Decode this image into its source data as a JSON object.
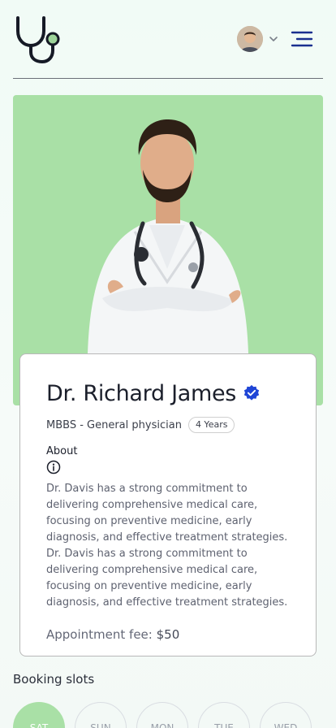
{
  "header": {
    "logo_icon": "stethoscope-icon",
    "avatar_icon": "user-avatar",
    "chevron_icon": "chevron-down-icon",
    "menu_icon": "hamburger-menu-icon",
    "brand_color": "#1b1f3a",
    "accent_color": "#1a3fc4"
  },
  "doctor": {
    "name": "Dr. Richard James",
    "verified_icon": "verified-badge-icon",
    "degree": "MBBS - General physician",
    "experience": "4 Years",
    "about_title": "About",
    "about_text": "Dr. Davis has a strong commitment to delivering comprehensive medical care, focusing on preventive medicine, early diagnosis, and effective treatment strategies. Dr. Davis has a strong commitment to delivering comprehensive medical care, focusing on preventive medicine, early diagnosis, and effective treatment strategies.",
    "fee_label": "Appointment fee:",
    "fee_value": "$50",
    "hero_bg_color": "#a9e0a6"
  },
  "booking": {
    "title": "Booking slots",
    "days": [
      "SAT",
      "SUN",
      "MON",
      "TUE",
      "WED"
    ],
    "selected_index": 0
  }
}
